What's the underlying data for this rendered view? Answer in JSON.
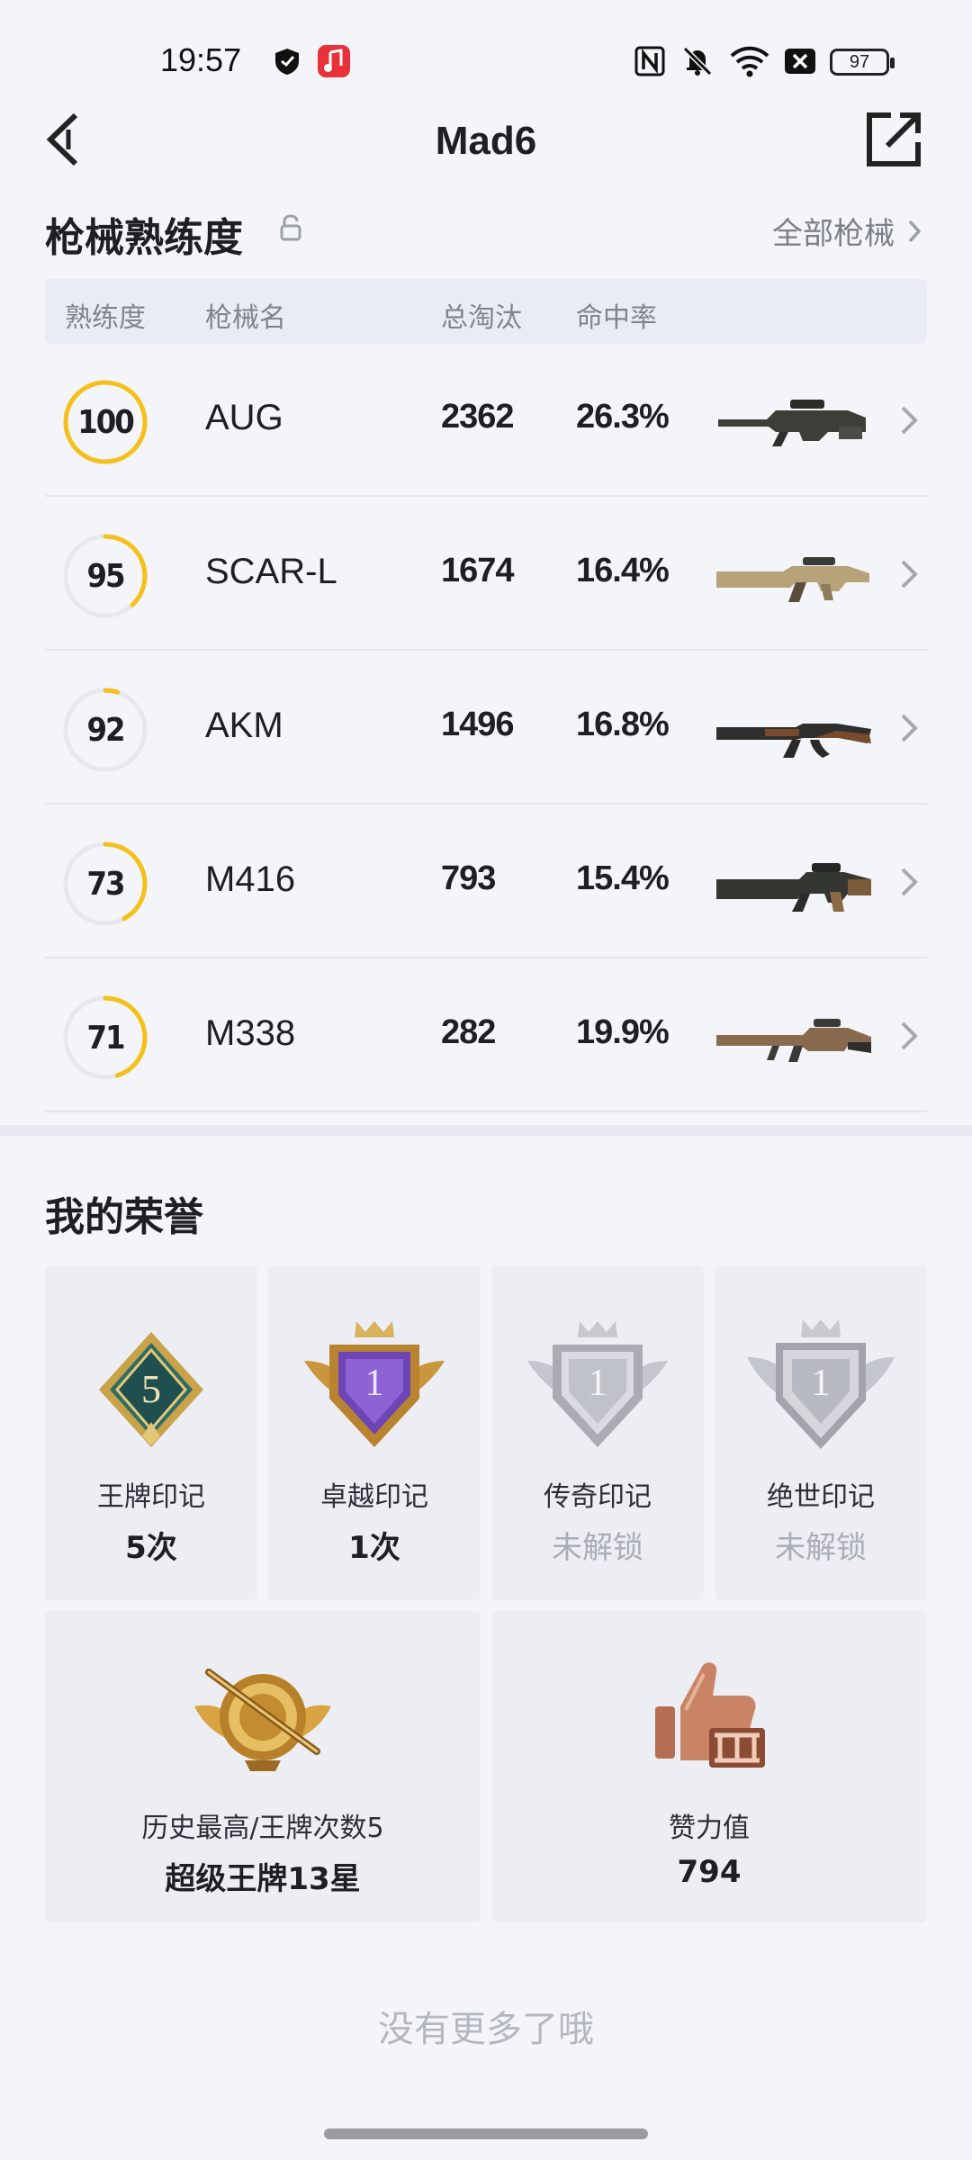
{
  "status": {
    "time": "19:57",
    "battery": "97"
  },
  "header": {
    "title": "Mad6"
  },
  "weapons": {
    "section_title": "枪械熟练度",
    "all_link": "全部枪械",
    "columns": [
      "熟练度",
      "枪械名",
      "总淘汰",
      "命中率"
    ],
    "rows": [
      {
        "level": "100",
        "name": "AUG",
        "kills": "2362",
        "rate": "26.3%",
        "progress": 1.0,
        "gun": "aug"
      },
      {
        "level": "95",
        "name": "SCAR-L",
        "kills": "1674",
        "rate": "16.4%",
        "progress": 0.38,
        "gun": "scar"
      },
      {
        "level": "92",
        "name": "AKM",
        "kills": "1496",
        "rate": "16.8%",
        "progress": 0.05,
        "gun": "akm"
      },
      {
        "level": "73",
        "name": "M416",
        "kills": "793",
        "rate": "15.4%",
        "progress": 0.42,
        "gun": "m416"
      },
      {
        "level": "71",
        "name": "M338",
        "kills": "282",
        "rate": "19.9%",
        "progress": 0.45,
        "gun": "m338"
      }
    ],
    "colors": {
      "ring": "#f5c01a",
      "ring_track": "#e6e8ed"
    }
  },
  "honors": {
    "section_title": "我的荣誉",
    "marks": [
      {
        "label": "王牌印记",
        "value": "5次",
        "locked": false,
        "icon": "ace-mark-icon",
        "badge_text": "5"
      },
      {
        "label": "卓越印记",
        "value": "1次",
        "locked": false,
        "icon": "excellence-mark-icon",
        "badge_text": "1"
      },
      {
        "label": "传奇印记",
        "value": "未解锁",
        "locked": true,
        "icon": "legend-mark-icon",
        "badge_text": "1"
      },
      {
        "label": "绝世印记",
        "value": "未解锁",
        "locked": true,
        "icon": "peerless-mark-icon",
        "badge_text": "1"
      }
    ],
    "stats": [
      {
        "label": "历史最高/王牌次数5",
        "value": "超级王牌13星",
        "icon": "super-ace-rank-icon"
      },
      {
        "label": "赞力值",
        "value": "794",
        "icon": "thumbs-up-icon"
      }
    ]
  },
  "footer": {
    "no_more": "没有更多了哦"
  }
}
